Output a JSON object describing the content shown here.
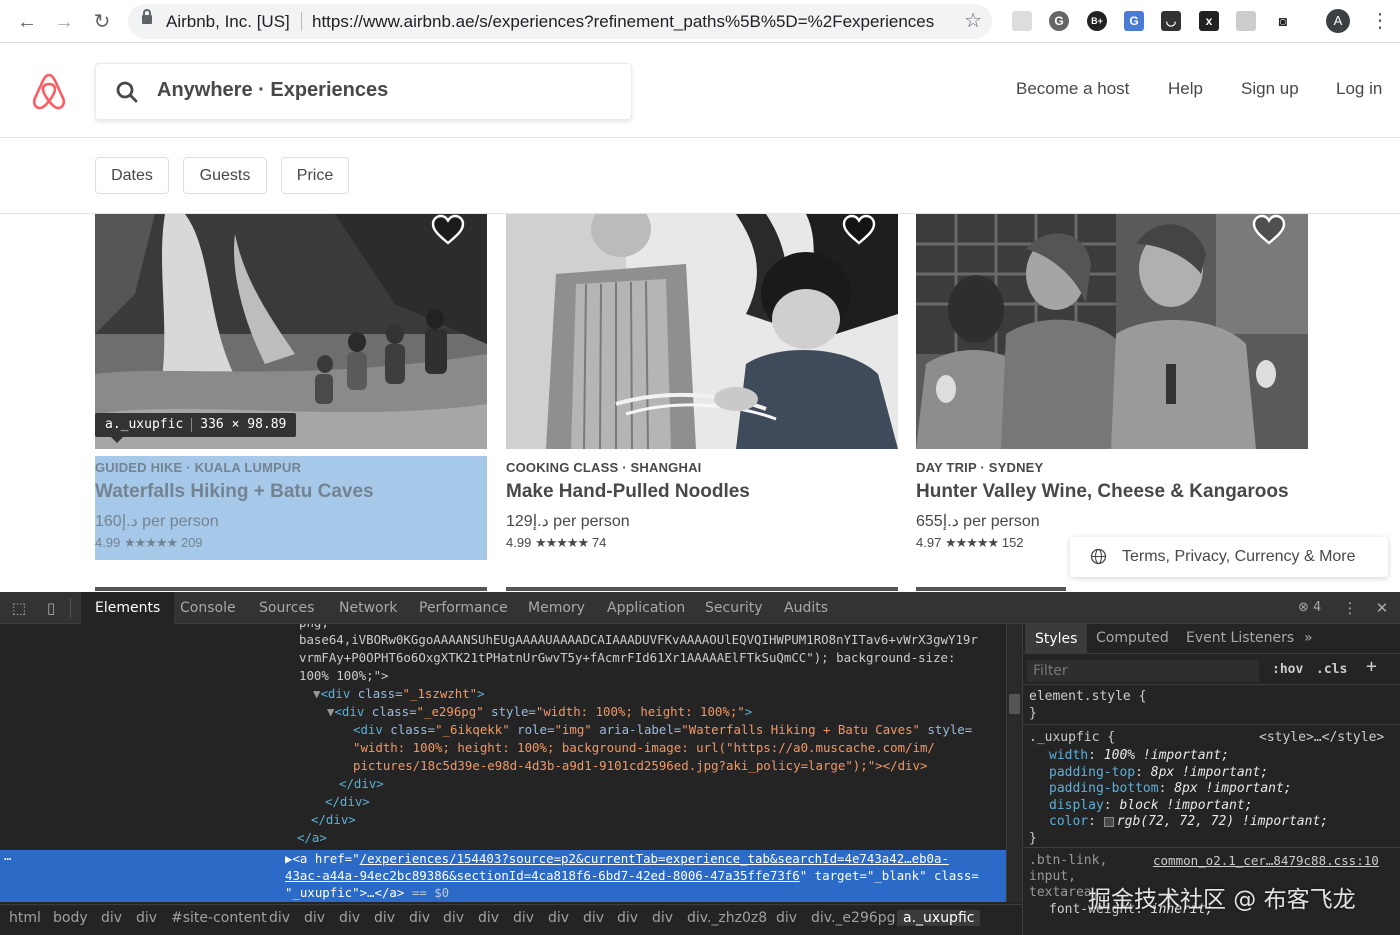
{
  "browser": {
    "org_label": "Airbnb, Inc. [US]",
    "url": "https://www.airbnb.ae/s/experiences?refinement_paths%5B%5D=%2Fexperiences",
    "profile_initial": "A",
    "extensions": [
      "B+",
      "x"
    ]
  },
  "header": {
    "search_text": "Anywhere · Experiences",
    "nav": [
      "Become a host",
      "Help",
      "Sign up",
      "Log in"
    ],
    "brand_color": "#FF5A5F"
  },
  "filters": [
    "Dates",
    "Guests",
    "Price"
  ],
  "cards": [
    {
      "category": "GUIDED HIKE · KUALA LUMPUR",
      "title": "Waterfalls Hiking + Batu Caves",
      "price": "160د.إ per person",
      "rating": "4.99",
      "stars": "★★★★★",
      "reviews": "209"
    },
    {
      "category": "COOKING CLASS · SHANGHAI",
      "title": "Make Hand-Pulled Noodles",
      "price": "129د.إ per person",
      "rating": "4.99",
      "stars": "★★★★★",
      "reviews": "74"
    },
    {
      "category": "DAY TRIP · SYDNEY",
      "title": "Hunter Valley Wine, Cheese & Kangaroos",
      "price": "655د.إ per person",
      "rating": "4.97",
      "stars": "★★★★★",
      "reviews": "152"
    }
  ],
  "inspect_tooltip": {
    "selector": "a._uxupfic",
    "size": "336 × 98.89"
  },
  "terms_text": "Terms, Privacy, Currency & More",
  "devtools": {
    "tabs": [
      "Elements",
      "Console",
      "Sources",
      "Network",
      "Performance",
      "Memory",
      "Application",
      "Security",
      "Audits"
    ],
    "warning_count": "4",
    "dom_lines": {
      "l0": "png,",
      "l1": "base64,iVBORw0KGgoAAAANSUhEUgAAAAUAAAADCAIAAADUVFKvAAAAOUlEQVQIHWPUM1RO8nYITav6+vWrX3gwY19r",
      "l2": "vrmFAy+P0OPHT6o6OxgXTK21tPHatnUrGwvT5y+fAcmrFId61Xr1AAAAAElFTkSuQmCC\"); background-size:",
      "l3": "100% 100%;\">",
      "l4_tag": "<div",
      "l4_attr": " class=",
      "l4_val": "\"_1szwzht\"",
      "l4_end": ">",
      "l5_tag": "<div",
      "l5_attr": " class=",
      "l5_val": "\"_e296pg\"",
      "l5_attr2": " style=",
      "l5_val2": "\"width: 100%; height: 100%;\"",
      "l5_end": ">",
      "l6_tag": "<div",
      "l6_attr": " class=",
      "l6_val": "\"_6ikqekk\"",
      "l6_attr2": " role=",
      "l6_val2": "\"img\"",
      "l6_attr3": " aria-label=",
      "l6_val3": "\"Waterfalls Hiking + Batu Caves\"",
      "l6_attr4": " style=",
      "l7": "\"width: 100%; height: 100%; background-image: url(\"https://a0.muscache.com/im/",
      "l8": "pictures/18c5d39e-e98d-4d3b-a9d1-9101cd2596ed.jpg?aki_policy=large\");\"></div>",
      "l9": "</div>",
      "l10": "</div>",
      "l11": "</div>",
      "l12": "</a>",
      "sel1_pre": "▶<a href=\"",
      "sel1_link": "/experiences/154403?source=p2&currentTab=experience_tab&searchId=4e743a42…eb0a-",
      "sel2_link": "43ac-a44a-94ec2bc89386&sectionId=4ca818f6-6bd7-42ed-8006-47a35ffe73f6",
      "sel2_post": "\" target=\"_blank\" class=",
      "sel3": "\"_uxupfic\">…</a>",
      "sel3_eq": " == $0",
      "ellipsis": "…"
    },
    "breadcrumbs": [
      "html",
      "body",
      "div",
      "div",
      "#site-content",
      "div",
      "div",
      "div",
      "div",
      "div",
      "div",
      "div",
      "div",
      "div",
      "div",
      "div",
      "div",
      "div._zhz0z8",
      "div",
      "div._e296pg",
      "a._uxupfic"
    ],
    "styles_tabs": [
      "Styles",
      "Computed",
      "Event Listeners",
      "»"
    ],
    "filter_placeholder": "Filter",
    "hov": ":hov",
    "cls": ".cls",
    "plus": "+",
    "element_style": "element.style {",
    "close_brace": "}",
    "rule_selector": "._uxupfic {",
    "rule_source": "<style>…</style>",
    "rule_props": [
      {
        "prop": "width",
        "value": "100% !important;"
      },
      {
        "prop": "padding-top",
        "value": "8px !important;"
      },
      {
        "prop": "padding-bottom",
        "value": "8px !important;"
      },
      {
        "prop": "display",
        "value": "block !important;"
      },
      {
        "prop": "color",
        "value": "rgb(72, 72, 72) !important;"
      }
    ],
    "rule2_selector": ".btn-link,",
    "rule2_source": "common_o2.1_cer…8479c88.css:10",
    "rule2_line2": "input,",
    "rule2_line3": "textarea,",
    "rule2_prop": "font-weight",
    "rule2_value": "inherit;"
  },
  "watermark": "掘金技术社区 @ 布客飞龙"
}
